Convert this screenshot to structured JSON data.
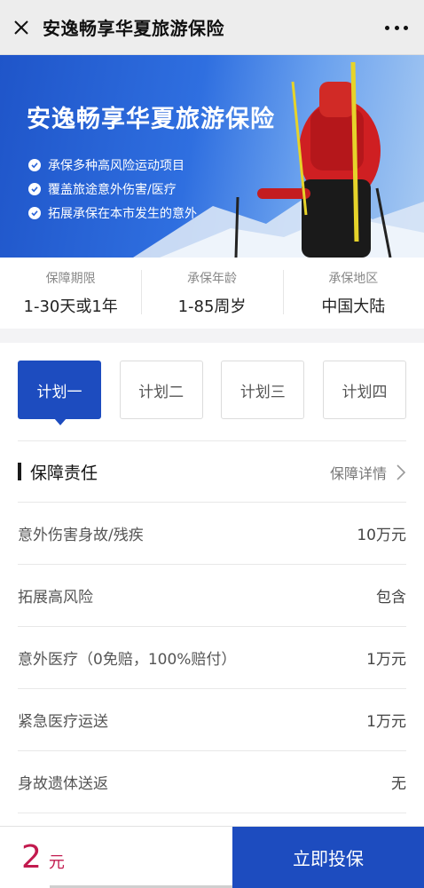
{
  "header": {
    "title": "安逸畅享华夏旅游保险",
    "close_icon": "close-icon",
    "more_icon": "more-dots-icon"
  },
  "hero": {
    "title": "安逸畅享华夏旅游保险",
    "features": [
      "承保多种高风险运动项目",
      "覆盖旅途意外伤害/医疗",
      "拓展承保在本市发生的意外"
    ]
  },
  "summary": [
    {
      "label": "保障期限",
      "value": "1-30天或1年"
    },
    {
      "label": "承保年龄",
      "value": "1-85周岁"
    },
    {
      "label": "承保地区",
      "value": "中国大陆"
    }
  ],
  "plans": {
    "selected": "计划一",
    "items": [
      "计划一",
      "计划二",
      "计划三",
      "计划四"
    ]
  },
  "coverage": {
    "title": "保障责任",
    "details_label": "保障详情",
    "rows": [
      {
        "name": "意外伤害身故/残疾",
        "value": "10万元"
      },
      {
        "name": "拓展高风险",
        "value": "包含"
      },
      {
        "name": "意外医疗（0免赔，100%赔付）",
        "value": "1万元"
      },
      {
        "name": "紧急医疗运送",
        "value": "1万元"
      },
      {
        "name": "身故遗体送返",
        "value": "无"
      }
    ]
  },
  "bottom_bar": {
    "price": "2",
    "unit": "元",
    "buy_label": "立即投保"
  },
  "colors": {
    "brand_blue": "#1d4cbf",
    "price_red": "#c21a4e"
  }
}
